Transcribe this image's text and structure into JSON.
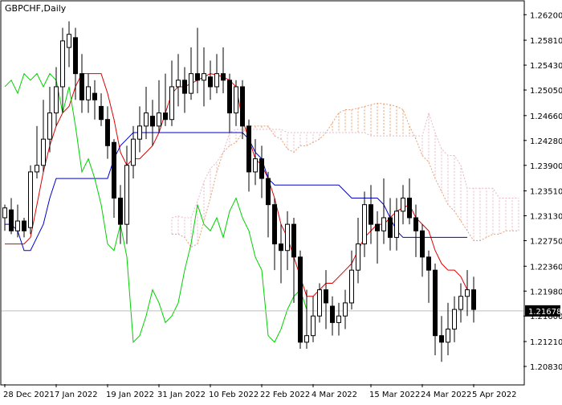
{
  "chart_title": "GBPCHF,Daily",
  "current_price_label": "1.21678",
  "colors": {
    "bull_fill": "#ffffff",
    "bear_fill": "#000000",
    "candle_outline": "#000000",
    "tenkan": "#e00000",
    "kijun": "#0000c8",
    "chikou": "#00d000",
    "cloud_bull": "#e8a070",
    "cloud_bear": "#e8b8c8",
    "price_line": "#bfbfbf",
    "price_tag_bg": "#000000",
    "price_tag_text": "#ffffff",
    "axis_text": "#000000"
  },
  "chart_data": {
    "type": "candlestick",
    "title": "GBPCHF,Daily",
    "ylim": [
      1.2056,
      1.264
    ],
    "y_ticks": [
      "1.26200",
      "1.25810",
      "1.25430",
      "1.25050",
      "1.24660",
      "1.24280",
      "1.23900",
      "1.23510",
      "1.23130",
      "1.22750",
      "1.22360",
      "1.21980",
      "1.21600",
      "1.21210",
      "1.20830"
    ],
    "x_ticks": [
      {
        "label": "28 Dec 2021",
        "index": 0
      },
      {
        "label": "7 Jan 2022",
        "index": 8
      },
      {
        "label": "19 Jan 2022",
        "index": 16
      },
      {
        "label": "31 Jan 2022",
        "index": 24
      },
      {
        "label": "10 Feb 2022",
        "index": 32
      },
      {
        "label": "22 Feb 2022",
        "index": 40
      },
      {
        "label": "4 Mar 2022",
        "index": 48
      },
      {
        "label": "15 Mar 2022",
        "index": 57
      },
      {
        "label": "24 Mar 2022",
        "index": 65
      },
      {
        "label": "5 Apr 2022",
        "index": 73
      }
    ],
    "last_price": 1.21678,
    "candles": [
      [
        1.231,
        1.2325,
        1.233,
        1.229
      ],
      [
        1.2322,
        1.229,
        1.234,
        1.2285
      ],
      [
        1.229,
        1.2305,
        1.233,
        1.228
      ],
      [
        1.2305,
        1.229,
        1.231,
        1.228
      ],
      [
        1.2295,
        1.238,
        1.239,
        1.2285
      ],
      [
        1.238,
        1.239,
        1.245,
        1.237
      ],
      [
        1.239,
        1.243,
        1.249,
        1.238
      ],
      [
        1.243,
        1.247,
        1.251,
        1.241
      ],
      [
        1.247,
        1.251,
        1.254,
        1.245
      ],
      [
        1.251,
        1.258,
        1.26,
        1.247
      ],
      [
        1.257,
        1.259,
        1.261,
        1.254
      ],
      [
        1.2585,
        1.253,
        1.26,
        1.249
      ],
      [
        1.253,
        1.249,
        1.256,
        1.247
      ],
      [
        1.249,
        1.251,
        1.253,
        1.247
      ],
      [
        1.25,
        1.249,
        1.252,
        1.246
      ],
      [
        1.248,
        1.246,
        1.25,
        1.245
      ],
      [
        1.246,
        1.242,
        1.248,
        1.24
      ],
      [
        1.2425,
        1.234,
        1.243,
        1.231
      ],
      [
        1.234,
        1.23,
        1.236,
        1.227
      ],
      [
        1.23,
        1.239,
        1.242,
        1.227
      ],
      [
        1.239,
        1.243,
        1.245,
        1.237
      ],
      [
        1.243,
        1.245,
        1.248,
        1.241
      ],
      [
        1.245,
        1.247,
        1.251,
        1.243
      ],
      [
        1.2465,
        1.245,
        1.249,
        1.242
      ],
      [
        1.245,
        1.247,
        1.252,
        1.244
      ],
      [
        1.247,
        1.246,
        1.253,
        1.245
      ],
      [
        1.246,
        1.251,
        1.255,
        1.245
      ],
      [
        1.251,
        1.252,
        1.256,
        1.248
      ],
      [
        1.252,
        1.25,
        1.254,
        1.247
      ],
      [
        1.25,
        1.253,
        1.257,
        1.249
      ],
      [
        1.253,
        1.252,
        1.26,
        1.25
      ],
      [
        1.252,
        1.253,
        1.257,
        1.248
      ],
      [
        1.2525,
        1.251,
        1.255,
        1.249
      ],
      [
        1.251,
        1.253,
        1.256,
        1.25
      ],
      [
        1.253,
        1.252,
        1.257,
        1.25
      ],
      [
        1.252,
        1.247,
        1.253,
        1.244
      ],
      [
        1.247,
        1.251,
        1.252,
        1.245
      ],
      [
        1.251,
        1.245,
        1.252,
        1.243
      ],
      [
        1.245,
        1.238,
        1.246,
        1.235
      ],
      [
        1.238,
        1.24,
        1.243,
        1.236
      ],
      [
        1.24,
        1.237,
        1.242,
        1.234
      ],
      [
        1.237,
        1.233,
        1.238,
        1.228
      ],
      [
        1.233,
        1.227,
        1.234,
        1.223
      ],
      [
        1.227,
        1.226,
        1.23,
        1.221
      ],
      [
        1.226,
        1.23,
        1.232,
        1.223
      ],
      [
        1.23,
        1.225,
        1.231,
        1.218
      ],
      [
        1.225,
        1.212,
        1.226,
        1.211
      ],
      [
        1.212,
        1.213,
        1.22,
        1.211
      ],
      [
        1.213,
        1.216,
        1.219,
        1.212
      ],
      [
        1.216,
        1.22,
        1.221,
        1.215
      ],
      [
        1.22,
        1.218,
        1.223,
        1.214
      ],
      [
        1.2175,
        1.215,
        1.219,
        1.213
      ],
      [
        1.215,
        1.216,
        1.218,
        1.213
      ],
      [
        1.216,
        1.218,
        1.22,
        1.214
      ],
      [
        1.218,
        1.223,
        1.226,
        1.217
      ],
      [
        1.223,
        1.227,
        1.231,
        1.221
      ],
      [
        1.227,
        1.233,
        1.235,
        1.225
      ],
      [
        1.233,
        1.23,
        1.236,
        1.227
      ],
      [
        1.23,
        1.229,
        1.232,
        1.224
      ],
      [
        1.229,
        1.231,
        1.237,
        1.227
      ],
      [
        1.231,
        1.228,
        1.234,
        1.226
      ],
      [
        1.228,
        1.232,
        1.234,
        1.226
      ],
      [
        1.232,
        1.234,
        1.236,
        1.23
      ],
      [
        1.234,
        1.231,
        1.237,
        1.23
      ],
      [
        1.231,
        1.229,
        1.233,
        1.225
      ],
      [
        1.229,
        1.225,
        1.23,
        1.222
      ],
      [
        1.225,
        1.223,
        1.226,
        1.218
      ],
      [
        1.223,
        1.213,
        1.224,
        1.21
      ],
      [
        1.213,
        1.212,
        1.216,
        1.209
      ],
      [
        1.212,
        1.214,
        1.218,
        1.21
      ],
      [
        1.214,
        1.217,
        1.219,
        1.212
      ],
      [
        1.217,
        1.219,
        1.221,
        1.215
      ],
      [
        1.219,
        1.22,
        1.223,
        1.216
      ],
      [
        1.22,
        1.217,
        1.222,
        1.215
      ]
    ],
    "series": [
      {
        "name": "Tenkan-sen",
        "color": "#e00000",
        "values": [
          1.227,
          1.227,
          1.227,
          1.227,
          1.228,
          1.233,
          1.238,
          1.242,
          1.245,
          1.247,
          1.248,
          1.251,
          1.253,
          1.253,
          1.253,
          1.253,
          1.25,
          1.246,
          1.241,
          1.239,
          1.24,
          1.24,
          1.241,
          1.242,
          1.244,
          1.247,
          1.25,
          1.251,
          1.251,
          1.2515,
          1.252,
          1.2525,
          1.253,
          1.2528,
          1.2525,
          1.252,
          1.251,
          1.246,
          1.243,
          1.24,
          1.239,
          1.237,
          1.234,
          1.23,
          1.228,
          1.225,
          1.222,
          1.219,
          1.219,
          1.22,
          1.221,
          1.221,
          1.222,
          1.223,
          1.224,
          1.226,
          1.228,
          1.229,
          1.23,
          1.23,
          1.231,
          1.232,
          1.2325,
          1.233,
          1.231,
          1.23,
          1.229,
          1.226,
          1.224,
          1.223,
          1.223,
          1.222,
          1.22
        ]
      },
      {
        "name": "Kijun-sen",
        "color": "#0000c8",
        "values": [
          1.23,
          1.23,
          1.229,
          1.226,
          1.226,
          1.228,
          1.23,
          1.234,
          1.237,
          1.237,
          1.237,
          1.237,
          1.237,
          1.237,
          1.237,
          1.237,
          1.237,
          1.24,
          1.242,
          1.243,
          1.244,
          1.244,
          1.244,
          1.244,
          1.244,
          1.244,
          1.244,
          1.244,
          1.244,
          1.244,
          1.244,
          1.244,
          1.244,
          1.244,
          1.244,
          1.244,
          1.244,
          1.244,
          1.243,
          1.241,
          1.24,
          1.237,
          1.236,
          1.236,
          1.236,
          1.236,
          1.236,
          1.236,
          1.236,
          1.236,
          1.236,
          1.236,
          1.236,
          1.235,
          1.234,
          1.234,
          1.234,
          1.234,
          1.234,
          1.233,
          1.231,
          1.229,
          1.228,
          1.228,
          1.228,
          1.228,
          1.228,
          1.228,
          1.228,
          1.228,
          1.228,
          1.228,
          1.228
        ]
      }
    ]
  }
}
